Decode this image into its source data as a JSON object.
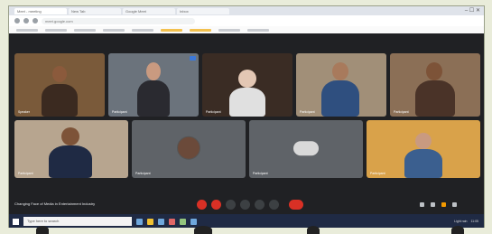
{
  "browser": {
    "tabs": [
      "Meet - meeting",
      "New Tab",
      "Google Meet",
      "Inbox"
    ],
    "url": "meet.google.com"
  },
  "participants": [
    {
      "name": "Speaker"
    },
    {
      "name": "Participant"
    },
    {
      "name": "Participant"
    },
    {
      "name": "Participant"
    },
    {
      "name": "Participant"
    },
    {
      "name": "Participant"
    },
    {
      "name": "Participant"
    },
    {
      "name": "Participant"
    },
    {
      "name": "Participant"
    }
  ],
  "meeting": {
    "title": "Changing Face of Media in Entertainment Industry"
  },
  "taskbar": {
    "search_placeholder": "Type here to search",
    "weather": "Light rain",
    "clock": "11:05"
  },
  "colors": {
    "page_bg": "#e9ecda",
    "meet_bg": "#202124",
    "end_call": "#d93025",
    "taskbar": "#1f2a44"
  }
}
